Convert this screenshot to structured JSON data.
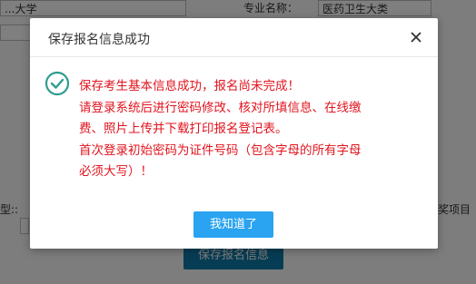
{
  "background": {
    "top_label": "专业名称：",
    "top_left_value": "...大学",
    "top_right_value": "医药卫生大类",
    "mid_label": "型::",
    "mid_right_text": "奖项目",
    "save_button_label": "保存报名信息"
  },
  "dialog": {
    "title": "保存报名信息成功",
    "message_lines": [
      "保存考生基本信息成功，报名尚未完成！",
      "请登录系统后进行密码修改、核对所填信息、在线缴",
      "费、照片上传并下载打印报名登记表。",
      "首次登录初始密码为证件号码（包含字母的所有字母",
      "必须大写）！"
    ],
    "confirm_label": "我知道了",
    "icons": {
      "status": "check-circle-icon",
      "close": "close-icon"
    },
    "colors": {
      "message": "#e1151f",
      "icon": "#2e9c8f",
      "confirm": "#2aa3f1"
    }
  }
}
